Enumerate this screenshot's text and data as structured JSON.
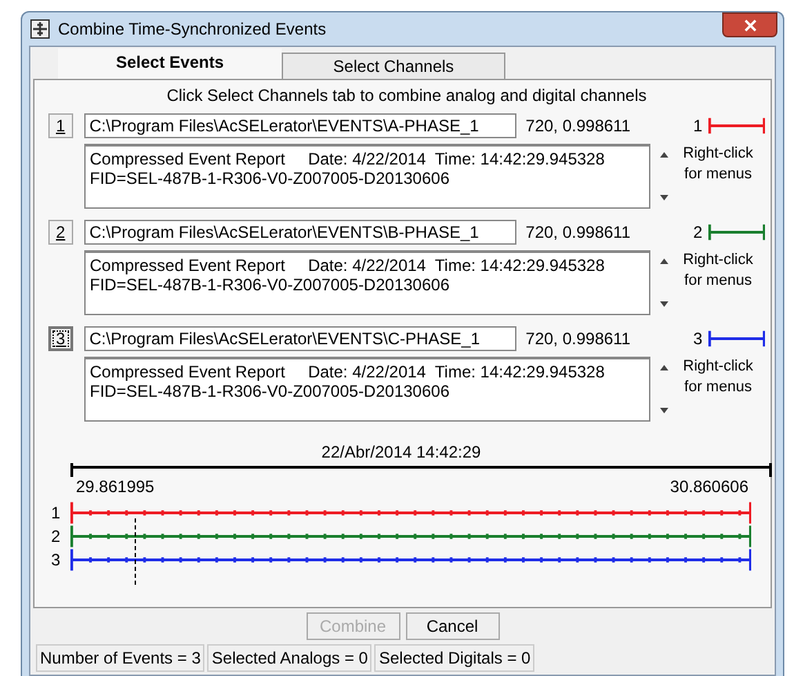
{
  "window": {
    "title": "Combine Time-Synchronized Events"
  },
  "tabs": [
    {
      "label": "Select Events",
      "selected": true
    },
    {
      "label": "Select Channels",
      "selected": false
    }
  ],
  "instruction": "Click Select Channels tab to combine analog and digital channels",
  "events": [
    {
      "number": "1",
      "focused": false,
      "path": "C:\\Program Files\\AcSELerator\\EVENTS\\A-PHASE_1",
      "info": "720, 0.998611",
      "channel": "1",
      "color": "#ee1c24",
      "lines": [
        "Compressed Event Report     Date: 4/22/2014  Time: 14:42:29.945328",
        "FID=SEL-487B-1-R306-V0-Z007005-D20130606"
      ],
      "hint": "Right-click for menus"
    },
    {
      "number": "2",
      "focused": false,
      "path": "C:\\Program Files\\AcSELerator\\EVENTS\\B-PHASE_1",
      "info": "720, 0.998611",
      "channel": "2",
      "color": "#1a7f2e",
      "lines": [
        "Compressed Event Report     Date: 4/22/2014  Time: 14:42:29.945328",
        "FID=SEL-487B-1-R306-V0-Z007005-D20130606"
      ],
      "hint": "Right-click for menus"
    },
    {
      "number": "3",
      "focused": true,
      "path": "C:\\Program Files\\AcSELerator\\EVENTS\\C-PHASE_1",
      "info": "720, 0.998611",
      "channel": "3",
      "color": "#1f2de8",
      "lines": [
        "Compressed Event Report     Date: 4/22/2014  Time: 14:42:29.945328",
        "FID=SEL-487B-1-R306-V0-Z007005-D20130606"
      ],
      "hint": "Right-click for menus"
    }
  ],
  "timeline": {
    "date": "22/Abr/2014 14:42:29",
    "start": "29.861995",
    "end": "30.860606",
    "tracks": [
      {
        "label": "1",
        "color": "#ee1c24"
      },
      {
        "label": "2",
        "color": "#1a7f2e"
      },
      {
        "label": "3",
        "color": "#1f2de8"
      }
    ]
  },
  "buttons": [
    {
      "label": "Combine",
      "disabled": true
    },
    {
      "label": "Cancel",
      "disabled": false
    }
  ],
  "status_bar": [
    "Number of Events = 3",
    "Selected Analogs = 0",
    "Selected Digitals = 0"
  ]
}
